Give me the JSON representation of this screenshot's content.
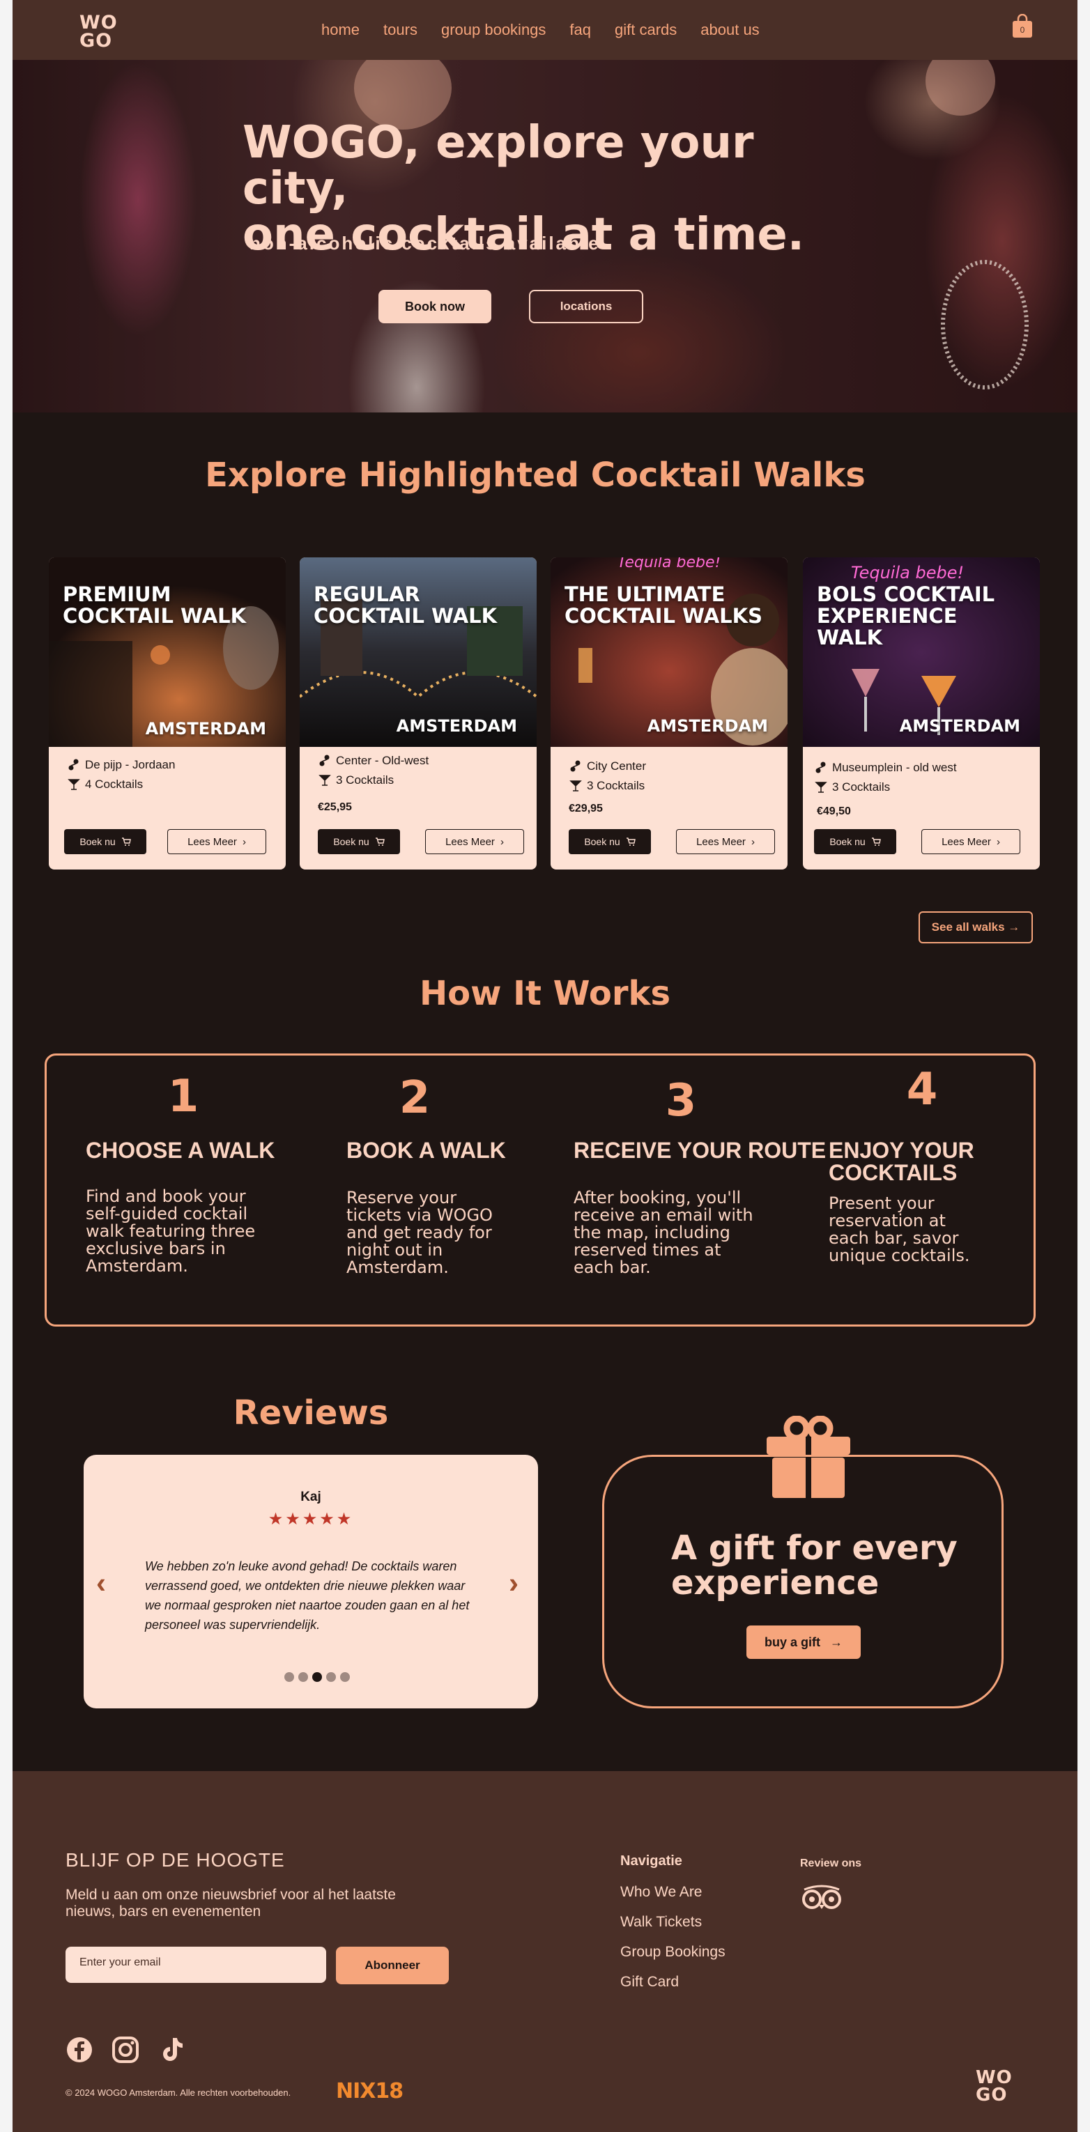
{
  "brand": {
    "logo_line1": "WO",
    "logo_line2": "GO"
  },
  "nav": {
    "items": [
      "home",
      "tours",
      "group bookings",
      "faq",
      "gift cards",
      "about us"
    ],
    "cart_count": "0"
  },
  "hero": {
    "title_line1": "WOGO, explore your city,",
    "title_line2": "one cocktail at a time.",
    "subtitle": "non-alcoholic cocktails available",
    "book_label": "Book now",
    "locations_label": "locations"
  },
  "walks": {
    "title": "Explore Highlighted Cocktail Walks",
    "cards": [
      {
        "title": "PREMIUM COCKTAIL WALK",
        "city": "AMSTERDAM",
        "location": "De pijp - Jordaan",
        "cocktails": "4 Cocktails",
        "price": "",
        "book": "Boek nu",
        "more": "Lees Meer"
      },
      {
        "title": "REGULAR COCKTAIL WALK",
        "city": "AMSTERDAM",
        "location": "Center - Old-west",
        "cocktails": "3 Cocktails",
        "price": "€25,95",
        "book": "Boek nu",
        "more": "Lees Meer"
      },
      {
        "title": "THE ULTIMATE COCKTAIL WALKS",
        "city": "AMSTERDAM",
        "location": "City Center",
        "cocktails": "3 Cocktails",
        "price": "€29,95",
        "book": "Boek nu",
        "more": "Lees Meer"
      },
      {
        "title": "BOLS COCKTAIL EXPERIENCE WALK",
        "city": "AMSTERDAM",
        "location": "Museumplein - old west",
        "cocktails": "3 Cocktails",
        "price": "€49,50",
        "book": "Boek nu",
        "more": "Lees Meer"
      }
    ],
    "neon_3": "Tequila bebe!",
    "neon_4": "Tequila bebe!",
    "see_all": "See all walks"
  },
  "how": {
    "title": "How It Works",
    "steps": [
      {
        "num": "1",
        "head1": "CHOOSE A WALK",
        "head2": "",
        "body": "Find and book your self-guided cocktail walk featuring three exclusive bars in Amsterdam."
      },
      {
        "num": "2",
        "head1": "BOOK A WALK",
        "head2": "",
        "body": "Reserve your tickets via WOGO and get ready for night out in Amsterdam."
      },
      {
        "num": "3",
        "head1": "RECEIVE YOUR ROUTE",
        "head2": "",
        "body": "After booking, you'll receive an email with the map, including reserved times at each bar."
      },
      {
        "num": "4",
        "head1": "ENJOY YOUR",
        "head2": "COCKTAILS",
        "body": "Present your reservation at each bar, savor unique cocktails."
      }
    ]
  },
  "reviews": {
    "title": "Reviews",
    "name": "Kaj",
    "rating": 5,
    "stars": "★★★★★",
    "text": "We hebben zo'n leuke avond gehad! De cocktails waren verrassend goed, we ontdekten drie nieuwe plekken waar we normaal gesproken niet naartoe zouden gaan en al het personeel was supervriendelijk.",
    "prev_glyph": "‹",
    "next_glyph": "›",
    "dot_count": 5,
    "active_dot": 3
  },
  "gift": {
    "title": "A gift for every experience",
    "button": "buy a gift"
  },
  "footer": {
    "news_title": "BLIJF OP DE HOOGTE",
    "news_text": "Meld u aan om onze nieuwsbrief voor al het laatste nieuws, bars en evenementen",
    "email_placeholder": "Enter your email",
    "subscribe": "Abonneer",
    "nav_title": "Navigatie",
    "nav_links": [
      "Who We Are",
      "Walk Tickets",
      "Group Bookings",
      "Gift Card"
    ],
    "review_title": "Review ons",
    "copyright": "© 2024 WOGO Amsterdam. Alle rechten voorbehouden.",
    "nix_badge": "NIX18",
    "social": [
      "facebook-icon",
      "instagram-icon",
      "tiktok-icon"
    ]
  },
  "colors": {
    "accent": "#f6a57c",
    "cream": "#fbd4c2",
    "dark": "#1e1513",
    "brown": "#4a2f27",
    "card": "#fde1d4",
    "star": "#c03628"
  }
}
